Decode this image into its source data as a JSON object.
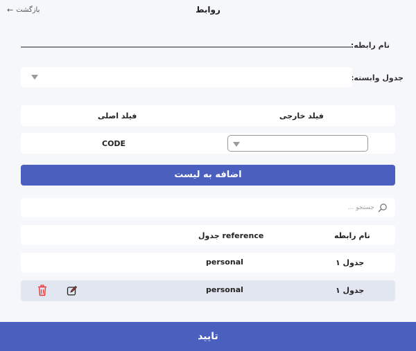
{
  "header": {
    "title": "روابط",
    "back_label": "بازگشت",
    "back_icon": "arrow-left-icon"
  },
  "form": {
    "relation_name_label": "نام رابطه:",
    "relation_name_value": "",
    "related_table_label": "جدول وابسته:",
    "related_table_value": ""
  },
  "mapping": {
    "foreign_field_header": "فیلد خارجی",
    "primary_field_header": "فیلد اصلی",
    "foreign_field_value": "",
    "primary_field_value": "CODE"
  },
  "add_button_label": "اضافه به لیست",
  "search": {
    "placeholder": "جستجو ...",
    "icon": "search-icon"
  },
  "table": {
    "headers": {
      "name": "نام رابطه",
      "reference": "جدول reference"
    },
    "rows": [
      {
        "name": "جدول ۱",
        "reference": "personal"
      },
      {
        "name": "جدول ۱",
        "reference": "personal"
      }
    ]
  },
  "row_actions": {
    "edit_icon": "edit-icon",
    "delete_icon": "trash-icon",
    "delete_color": "#e53935"
  },
  "confirm_label": "تایید",
  "colors": {
    "accent": "#4b5fbf",
    "background": "#f6f7fb",
    "highlight_row": "#e2e6f0"
  }
}
